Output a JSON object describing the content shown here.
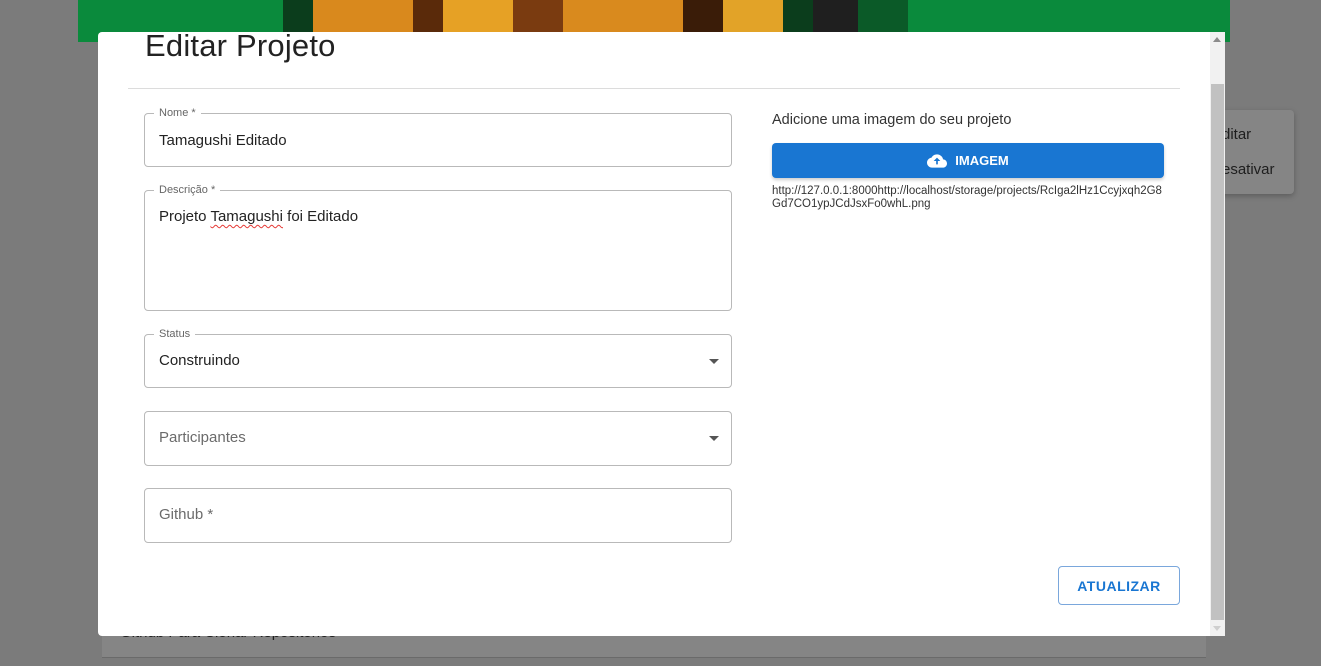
{
  "background": {
    "menu_items": [
      "ditar",
      "esativar"
    ],
    "card_text": "Github Para Clonar Repositórios"
  },
  "dialog": {
    "title": "Editar Projeto",
    "fields": {
      "nome": {
        "label": "Nome *",
        "value": "Tamagushi Editado"
      },
      "descricao": {
        "label": "Descrição *",
        "value_prefix": "Projeto ",
        "value_misspelled": "Tamagushi",
        "value_suffix": " foi Editado"
      },
      "status": {
        "label": "Status",
        "value": "Construindo"
      },
      "participantes": {
        "placeholder": "Participantes"
      },
      "github": {
        "placeholder": "Github *"
      }
    },
    "image": {
      "label": "Adicione uma imagem do seu projeto",
      "button_label": "IMAGEM",
      "url": "http://127.0.0.1:8000http://localhost/storage/projects/RcIga2lHz1Ccyjxqh2G8Gd7CO1ypJCdJsxFo0whL.png"
    },
    "submit_label": "ATUALIZAR"
  },
  "colors": {
    "primary": "#1976d2",
    "banner": "#0a8a3c",
    "overlay": "#7b7b7b"
  },
  "icons": {
    "upload": "cloud-upload-icon",
    "dropdown": "arrow-drop-down-icon"
  }
}
